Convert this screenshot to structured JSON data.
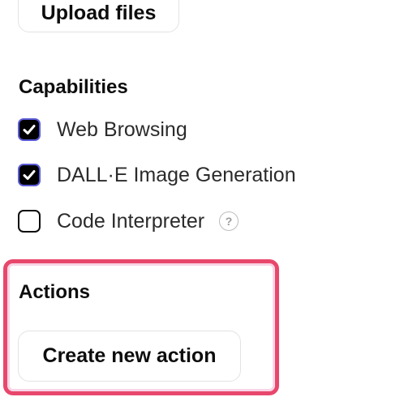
{
  "upload": {
    "label": "Upload files"
  },
  "capabilities": {
    "title": "Capabilities",
    "items": [
      {
        "label": "Web Browsing",
        "checked": true
      },
      {
        "label": "DALL·E Image Generation",
        "checked": true
      },
      {
        "label": "Code Interpreter",
        "checked": false,
        "help_icon": "help-icon",
        "help_glyph": "?"
      }
    ]
  },
  "actions": {
    "title": "Actions",
    "create_label": "Create new action",
    "highlight_color": "#e8476c"
  },
  "colors": {
    "checkbox_checked_bg": "#000000",
    "checkbox_checked_border": "#5b5bd6",
    "text": "#0d0d0d"
  }
}
